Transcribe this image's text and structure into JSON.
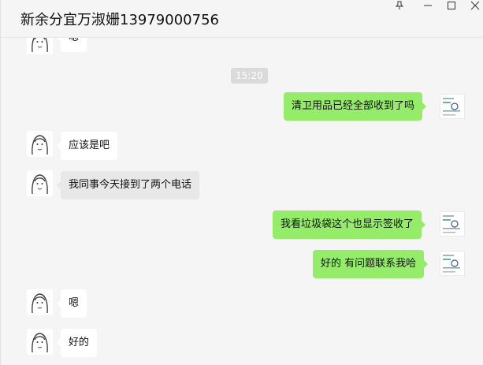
{
  "window": {
    "title": "新余分宜万淑姗13979000756",
    "pin_icon": "pin-icon",
    "minimize_icon": "minimize-icon",
    "maximize_icon": "maximize-icon",
    "close_icon": "close-icon"
  },
  "chat": {
    "time": "15:20",
    "partial_top_text": "嗯",
    "messages": [
      {
        "side": "right",
        "text": "清卫用品已经全部收到了吗"
      },
      {
        "side": "left",
        "text": "应该是吧"
      },
      {
        "side": "left",
        "text": "我同事今天接到了两个电话"
      },
      {
        "side": "right",
        "text": "我看垃圾袋这个也显示签收了"
      },
      {
        "side": "right",
        "text": "好的 有问题联系我哈"
      },
      {
        "side": "left",
        "text": "嗯"
      },
      {
        "side": "left",
        "text": "好的"
      }
    ]
  },
  "colors": {
    "background": "#f5f5f5",
    "bubble_left": "#ffffff",
    "bubble_gray": "#e8e8e8",
    "bubble_right": "#95ec69",
    "time_pill": "#dadada"
  }
}
